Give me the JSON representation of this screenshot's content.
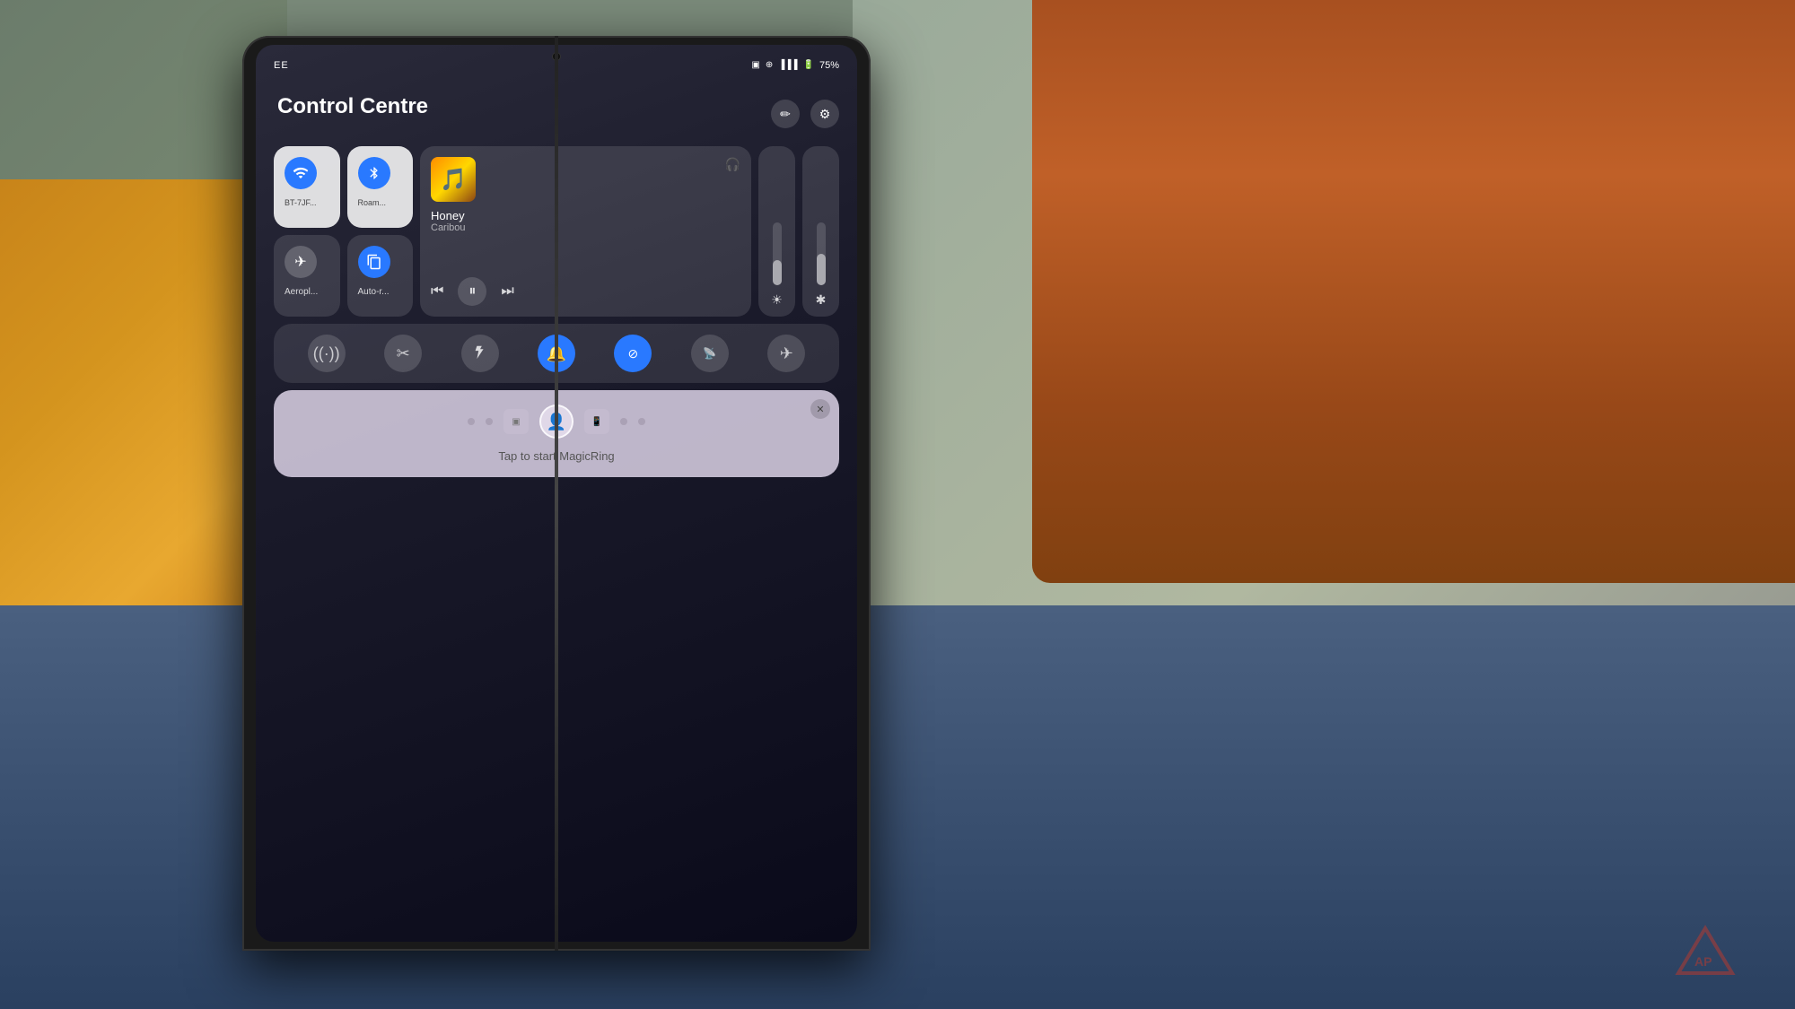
{
  "scene": {
    "bg_color": "#7a8a7a"
  },
  "phone": {
    "status_bar": {
      "carrier": "EE",
      "icons": [
        "⊞",
        "☁",
        "📶",
        "🔋"
      ],
      "battery": "75%"
    },
    "control_centre": {
      "title": "Control Centre",
      "edit_icon": "✏️",
      "settings_icon": "⚙️",
      "tiles": {
        "wifi": {
          "label": "BT-7JF...",
          "active": true,
          "icon": "wifi"
        },
        "bluetooth": {
          "label": "Roam...",
          "active": true,
          "icon": "bluetooth"
        },
        "aeroplane": {
          "label": "Aeropl...",
          "active": false,
          "icon": "✈"
        },
        "auto_rotate": {
          "label": "Auto-r...",
          "active": true,
          "icon": "⟳"
        }
      },
      "media": {
        "song": "Honey",
        "artist": "Caribou",
        "headphone_icon": "🎧",
        "prev_icon": "⏮",
        "play_icon": "⏸",
        "next_icon": "⏭"
      },
      "sliders": {
        "brightness": {
          "icon": "☀",
          "value": 40
        },
        "bluetooth_vol": {
          "icon": "✱",
          "value": 50
        }
      },
      "toggles": [
        {
          "id": "hotspot",
          "icon": "((·))",
          "active": false
        },
        {
          "id": "scissors",
          "icon": "✂",
          "active": false
        },
        {
          "id": "torch",
          "icon": "🔦",
          "active": false
        },
        {
          "id": "mute",
          "icon": "🔔",
          "active": true
        },
        {
          "id": "nfc",
          "icon": "◎",
          "active": true
        },
        {
          "id": "cast",
          "icon": "((·))",
          "active": false
        },
        {
          "id": "airplane",
          "icon": "✈",
          "active": false
        }
      ],
      "magic_ring": {
        "title": "Tap to start MagicRing",
        "close_icon": "✕"
      }
    }
  }
}
